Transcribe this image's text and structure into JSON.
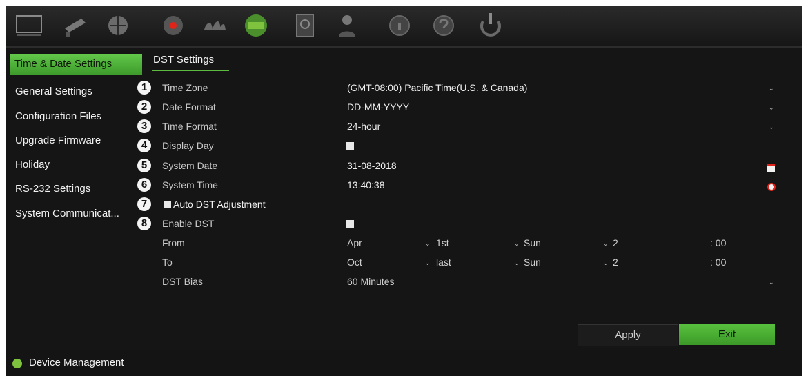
{
  "toolbar": {
    "icons": [
      "monitor-icon",
      "camera-icon",
      "network-icon",
      "record-icon",
      "alarm-icon",
      "device-icon",
      "storage-icon",
      "user-icon",
      "info-icon",
      "help-icon",
      "power-icon"
    ]
  },
  "sidebar": {
    "header": "Time & Date Settings",
    "items": [
      {
        "label": "General Settings"
      },
      {
        "label": "Configuration Files"
      },
      {
        "label": "Upgrade Firmware"
      },
      {
        "label": "Holiday"
      },
      {
        "label": "RS-232 Settings"
      },
      {
        "label": "System Communicat..."
      }
    ]
  },
  "tab": {
    "label": "DST Settings"
  },
  "callouts": [
    "1",
    "2",
    "3",
    "4",
    "5",
    "6",
    "7",
    "8"
  ],
  "rows": {
    "time_zone": {
      "label": "Time Zone",
      "value": "(GMT-08:00) Pacific Time(U.S. & Canada)"
    },
    "date_format": {
      "label": "Date Format",
      "value": "DD-MM-YYYY"
    },
    "time_format": {
      "label": "Time Format",
      "value": "24-hour"
    },
    "display_day": {
      "label": "Display Day",
      "checked": false
    },
    "system_date": {
      "label": "System Date",
      "value": "31-08-2018"
    },
    "system_time": {
      "label": "System Time",
      "value": "13:40:38"
    },
    "auto_dst": {
      "label": "Auto DST Adjustment",
      "checked": false
    },
    "enable_dst": {
      "label": "Enable DST",
      "checked": false
    },
    "from": {
      "label": "From",
      "month": "Apr",
      "week": "1st",
      "day": "Sun",
      "hour": "2",
      "minute": ": 00"
    },
    "to": {
      "label": "To",
      "month": "Oct",
      "week": "last",
      "day": "Sun",
      "hour": "2",
      "minute": ": 00"
    },
    "dst_bias": {
      "label": "DST Bias",
      "value": "60 Minutes"
    }
  },
  "buttons": {
    "apply": "Apply",
    "exit": "Exit"
  },
  "status": {
    "text": "Device Management"
  },
  "colors": {
    "accent": "#5dbb3f",
    "background": "#151515",
    "alert": "#e0241a"
  }
}
